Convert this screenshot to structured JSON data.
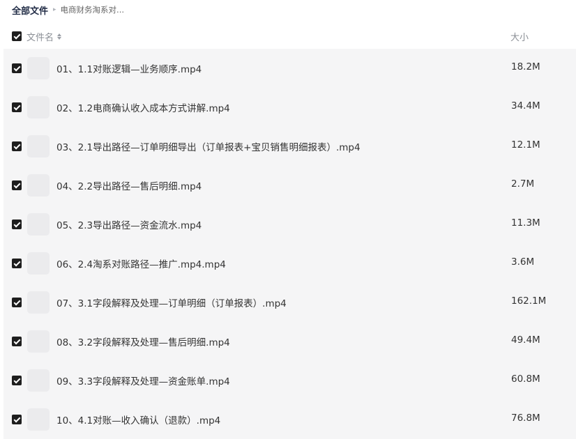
{
  "breadcrumb": {
    "root": "全部文件",
    "current": "电商财务淘系对..."
  },
  "header": {
    "name_label": "文件名",
    "size_label": "大小",
    "select_all_checked": true
  },
  "files": [
    {
      "name": "01、1.1对账逻辑—业务顺序.mp4",
      "size": "18.2M",
      "checked": true
    },
    {
      "name": "02、1.2电商确认收入成本方式讲解.mp4",
      "size": "34.4M",
      "checked": true
    },
    {
      "name": "03、2.1导出路径—订单明细导出（订单报表+宝贝销售明细报表）.mp4",
      "size": "12.1M",
      "checked": true
    },
    {
      "name": "04、2.2导出路径—售后明细.mp4",
      "size": "2.7M",
      "checked": true
    },
    {
      "name": "05、2.3导出路径—资金流水.mp4",
      "size": "11.3M",
      "checked": true
    },
    {
      "name": "06、2.4淘系对账路径—推广.mp4.mp4",
      "size": "3.6M",
      "checked": true
    },
    {
      "name": "07、3.1字段解释及处理—订单明细（订单报表）.mp4",
      "size": "162.1M",
      "checked": true
    },
    {
      "name": "08、3.2字段解释及处理—售后明细.mp4",
      "size": "49.4M",
      "checked": true
    },
    {
      "name": "09、3.3字段解释及处理—资金账单.mp4",
      "size": "60.8M",
      "checked": true
    },
    {
      "name": "10、4.1对账—收入确认（退款）.mp4",
      "size": "76.8M",
      "checked": true
    }
  ]
}
